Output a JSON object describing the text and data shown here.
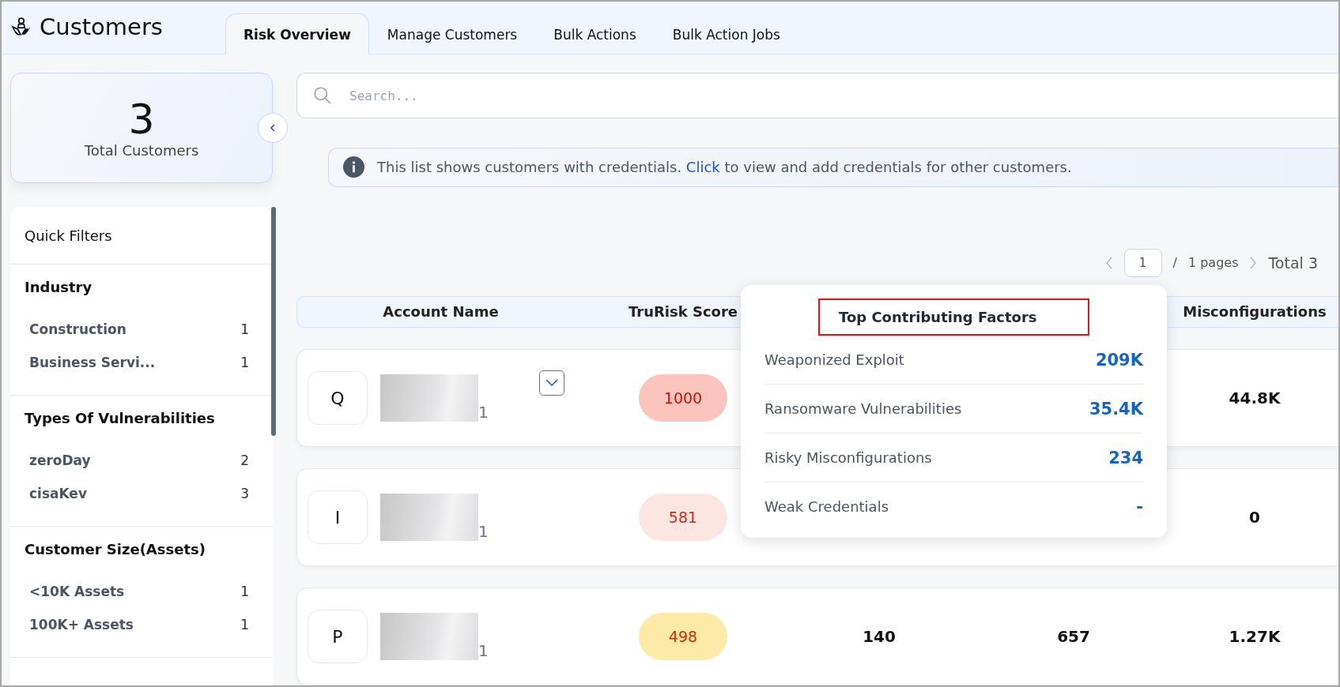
{
  "header": {
    "title": "Customers"
  },
  "tabs": [
    {
      "label": "Risk Overview",
      "selected": true
    },
    {
      "label": "Manage Customers",
      "selected": false
    },
    {
      "label": "Bulk Actions",
      "selected": false
    },
    {
      "label": "Bulk Action Jobs",
      "selected": false
    }
  ],
  "summary": {
    "count": "3",
    "label": "Total Customers"
  },
  "quick_filters": {
    "title": "Quick Filters",
    "sections": [
      {
        "title": "Industry",
        "items": [
          {
            "label": "Construction",
            "count": "1"
          },
          {
            "label": "Business Servi...",
            "count": "1"
          }
        ]
      },
      {
        "title": "Types Of Vulnerabilities",
        "items": [
          {
            "label": "zeroDay",
            "count": "2"
          },
          {
            "label": "cisaKev",
            "count": "3"
          }
        ]
      },
      {
        "title": "Customer Size(Assets)",
        "items": [
          {
            "label": "<10K Assets",
            "count": "1"
          },
          {
            "label": "100K+ Assets",
            "count": "1"
          }
        ]
      }
    ]
  },
  "search": {
    "placeholder": "Search..."
  },
  "notice": {
    "before": "This list shows customers with credentials.",
    "link": "Click",
    "after": "to view and add credentials for other customers."
  },
  "pagination": {
    "page": "1",
    "separator": "/",
    "pages": "1 pages",
    "total": "Total 3"
  },
  "table": {
    "columns": [
      "Account Name",
      "TruRisk Score",
      null,
      null,
      "Misconfigurations"
    ],
    "rows": [
      {
        "initial": "Q",
        "name_tail": "1",
        "expandable": true,
        "score": "1000",
        "color": "#fbc4bd",
        "column_3": null,
        "column_4": null,
        "misconfigurations": "44.8K"
      },
      {
        "initial": "I",
        "name_tail": "1",
        "expandable": false,
        "score": "581",
        "color": "#fde6e1",
        "column_3": null,
        "column_4": null,
        "misconfigurations": "0"
      },
      {
        "initial": "P",
        "name_tail": "1",
        "expandable": false,
        "score": "498",
        "color": "#fdeaa8",
        "column_3": "140",
        "column_4": "657",
        "misconfigurations": "1.27K"
      }
    ]
  },
  "popover": {
    "title": "Top Contributing Factors",
    "highlighted": true,
    "factors": [
      {
        "label": "Weaponized Exploit",
        "value": "209K"
      },
      {
        "label": "Ransomware Vulnerabilities",
        "value": "35.4K"
      },
      {
        "label": "Risky Misconfigurations",
        "value": "234"
      },
      {
        "label": "Weak Credentials",
        "value": "-"
      }
    ]
  }
}
